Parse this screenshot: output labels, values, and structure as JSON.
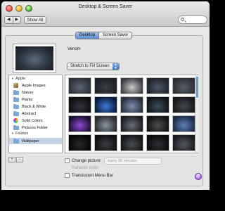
{
  "window": {
    "title": "Desktop & Screen Saver"
  },
  "toolbar": {
    "back": "◀",
    "forward": "▶",
    "show_all": "Show All",
    "search_icon": "search-icon"
  },
  "tabs": [
    {
      "label": "Desktop",
      "active": true
    },
    {
      "label": "Screen Saver",
      "active": false
    }
  ],
  "wallpaper": {
    "name": "Venom",
    "fill_mode": "Stretch to Fill Screen"
  },
  "sources": {
    "apple_header": "Apple",
    "apple_items": [
      "Apple Images",
      "Nature",
      "Plants",
      "Black & White",
      "Abstract",
      "Solid Colors",
      "Pictures Folder"
    ],
    "folders_header": "Folders",
    "folders_items": [
      "Wallpaper"
    ],
    "selected": "Wallpaper",
    "add": "+",
    "remove": "−"
  },
  "thumbnails": [
    {
      "colors": [
        "#2d3138",
        "#5b6471"
      ]
    },
    {
      "colors": [
        "#1d2024",
        "#3b3f45"
      ]
    },
    {
      "colors": [
        "#3a3d42",
        "#c9c9c9"
      ]
    },
    {
      "colors": [
        "#20242b",
        "#4a5566"
      ]
    },
    {
      "colors": [
        "#2b2f35",
        "#575d65"
      ]
    },
    {
      "colors": [
        "#0d0e10",
        "#30343a"
      ]
    },
    {
      "colors": [
        "#0a1a3a",
        "#3c7ad9"
      ]
    },
    {
      "colors": [
        "#2a2f3a",
        "#7b8db0"
      ]
    },
    {
      "colors": [
        "#101418",
        "#3c4a5a"
      ]
    },
    {
      "colors": [
        "#16181b",
        "#44484e"
      ]
    },
    {
      "colors": [
        "#1a0e2e",
        "#8f4ad6"
      ]
    },
    {
      "colors": [
        "#2a2e34",
        "#8a939e"
      ]
    },
    {
      "colors": [
        "#1b1d22",
        "#6a7078"
      ]
    },
    {
      "colors": [
        "#121212",
        "#4d4d4d"
      ]
    },
    {
      "colors": [
        "#1e2c45",
        "#5f7fb8"
      ]
    },
    {
      "colors": [
        "#050505",
        "#2a2a2a"
      ]
    },
    {
      "colors": [
        "#0f1012",
        "#3a3d42"
      ]
    },
    {
      "colors": [
        "#141618",
        "#4a4d52"
      ]
    },
    {
      "colors": [
        "#0b0c0e",
        "#2c2f34"
      ]
    },
    {
      "colors": [
        "#1a1c20",
        "#55585e"
      ]
    }
  ],
  "options": {
    "change_picture": "Change picture:",
    "change_interval": "every 30 minutes",
    "random_order": "Random order",
    "translucent_menu_bar": "Translucent Menu Bar"
  },
  "help": "?"
}
